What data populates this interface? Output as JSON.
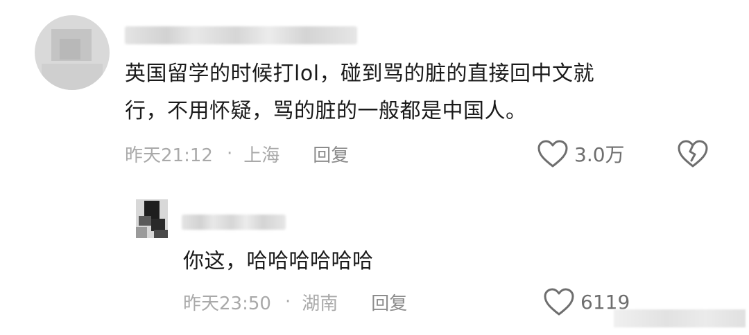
{
  "main_comment": {
    "text_line1": "英国留学的时候打lol，碰到骂的脏的直接回中文就",
    "text_line2": "行，不用怀疑，骂的脏的一般都是中国人。",
    "time": "昨天21:12",
    "separator": "·",
    "location": "上海",
    "reply_label": "回复",
    "like_count": "3.0万"
  },
  "reply_comment": {
    "text": "你这，哈哈哈哈哈哈",
    "time": "昨天23:50",
    "separator": "·",
    "location": "湖南",
    "reply_label": "回复",
    "like_count": "6119"
  },
  "icons": {
    "like": "heart-outline-icon",
    "dislike": "broken-heart-icon"
  },
  "colors": {
    "text": "#1a1a1a",
    "meta": "#a9a9a9",
    "icon": "#6e6e6e"
  }
}
